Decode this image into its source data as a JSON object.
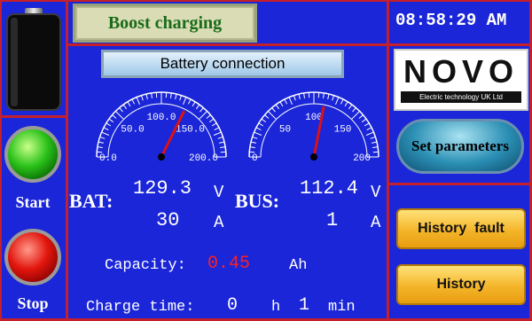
{
  "header": {
    "mode_label": "Boost charging",
    "clock": "08:58:29 AM"
  },
  "connection": {
    "label": "Battery connection"
  },
  "gauges": {
    "bat": {
      "ticks": [
        "0.0",
        "50.0",
        "100.0",
        "150.0",
        "200.0"
      ],
      "value": 129.3
    },
    "bus": {
      "ticks": [
        "0",
        "50",
        "100",
        "150",
        "200"
      ],
      "value": 112.4
    }
  },
  "readings": {
    "bat_label": "BAT:",
    "bat_voltage": "129.3",
    "bat_voltage_unit": "V",
    "bat_current": "30",
    "bat_current_unit": "A",
    "bus_label": "BUS:",
    "bus_voltage": "112.4",
    "bus_voltage_unit": "V",
    "bus_current": "1",
    "bus_current_unit": "A"
  },
  "capacity": {
    "label": "Capacity:",
    "value": "0.45",
    "unit": "Ah"
  },
  "charge_time": {
    "label": "Charge time:",
    "hours": "0",
    "hours_unit": "h",
    "minutes": "1",
    "minutes_unit": "min"
  },
  "controls": {
    "start_label": "Start",
    "stop_label": "Stop"
  },
  "logo": {
    "brand": "NOVO",
    "tagline": "Electric technology UK Ltd"
  },
  "buttons": {
    "set_parameters": "Set parameters",
    "history_fault": "History  fault",
    "history": "History"
  },
  "colors": {
    "background": "#1a26d8",
    "divider": "#c4202b",
    "capacity_value": "#ff2020"
  }
}
